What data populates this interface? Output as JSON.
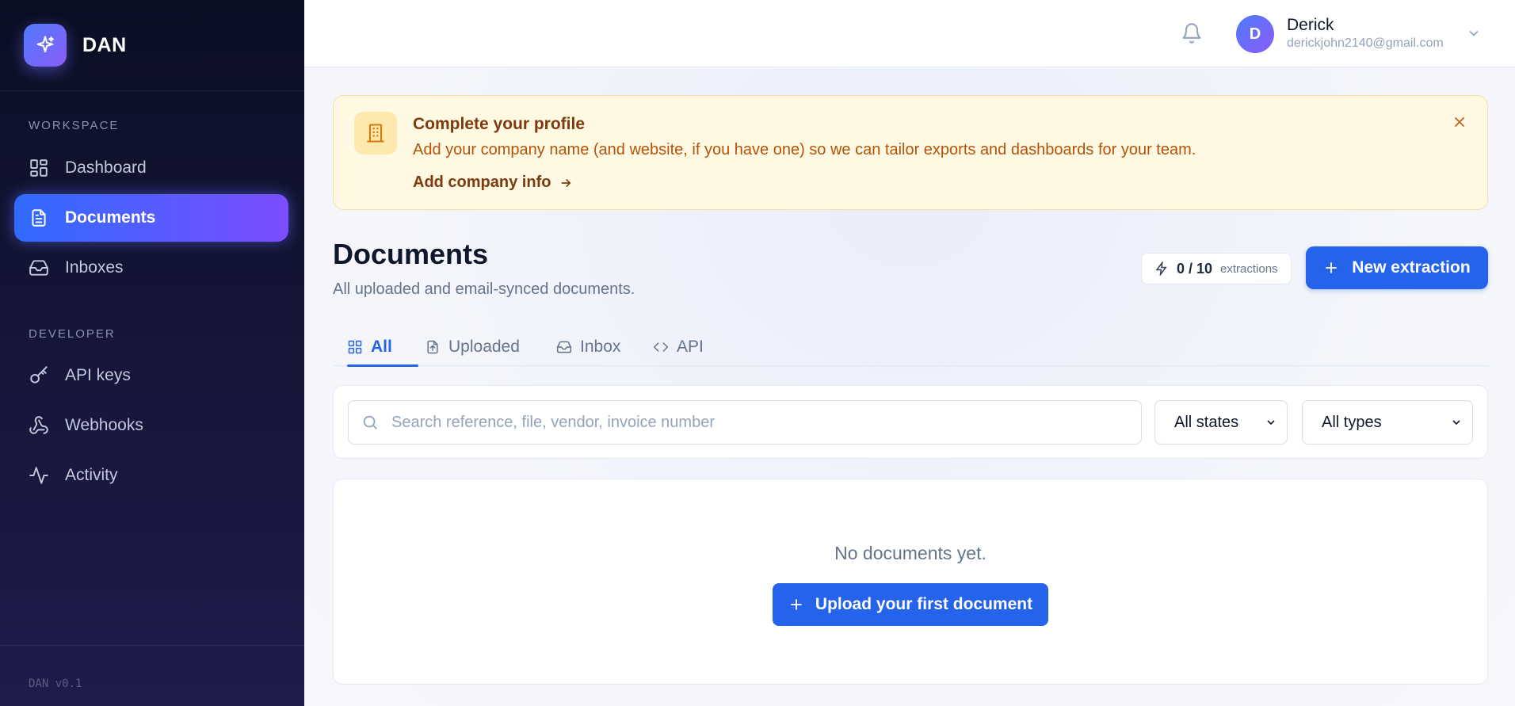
{
  "brand": {
    "name": "DAN"
  },
  "sidebar": {
    "workspace_label": "WORKSPACE",
    "developer_label": "DEVELOPER",
    "items": [
      {
        "label": "Dashboard",
        "icon": "grid-icon"
      },
      {
        "label": "Documents",
        "icon": "document-icon",
        "active": true
      },
      {
        "label": "Inboxes",
        "icon": "inbox-icon"
      },
      {
        "label": "API keys",
        "icon": "key-icon"
      },
      {
        "label": "Webhooks",
        "icon": "webhook-icon"
      },
      {
        "label": "Activity",
        "icon": "activity-icon"
      }
    ],
    "version": "DAN v0.1"
  },
  "topbar": {
    "user": {
      "initial": "D",
      "name": "Derick",
      "email": "derickjohn2140@gmail.com"
    }
  },
  "banner": {
    "title": "Complete your profile",
    "text": "Add your company name (and website, if you have one) so we can tailor exports and dashboards for your team.",
    "link": "Add company info"
  },
  "page": {
    "title": "Documents",
    "subtitle": "All uploaded and email-synced documents.",
    "quota": {
      "value": "0 / 10",
      "unit": "extractions"
    },
    "new_button": "New extraction"
  },
  "tabs": [
    {
      "label": "All",
      "icon": "grid-icon",
      "active": true
    },
    {
      "label": "Uploaded",
      "icon": "file-upload-icon"
    },
    {
      "label": "Inbox",
      "icon": "inbox-icon"
    },
    {
      "label": "API",
      "icon": "code-icon"
    }
  ],
  "filters": {
    "search_placeholder": "Search reference, file, vendor, invoice number",
    "states": "All states",
    "types": "All types"
  },
  "empty": {
    "text": "No documents yet.",
    "upload_button": "Upload your first document"
  },
  "colors": {
    "accent": "#2563eb",
    "banner_bg": "#fff9e3",
    "sidebar_bg": "#0b0f24"
  }
}
